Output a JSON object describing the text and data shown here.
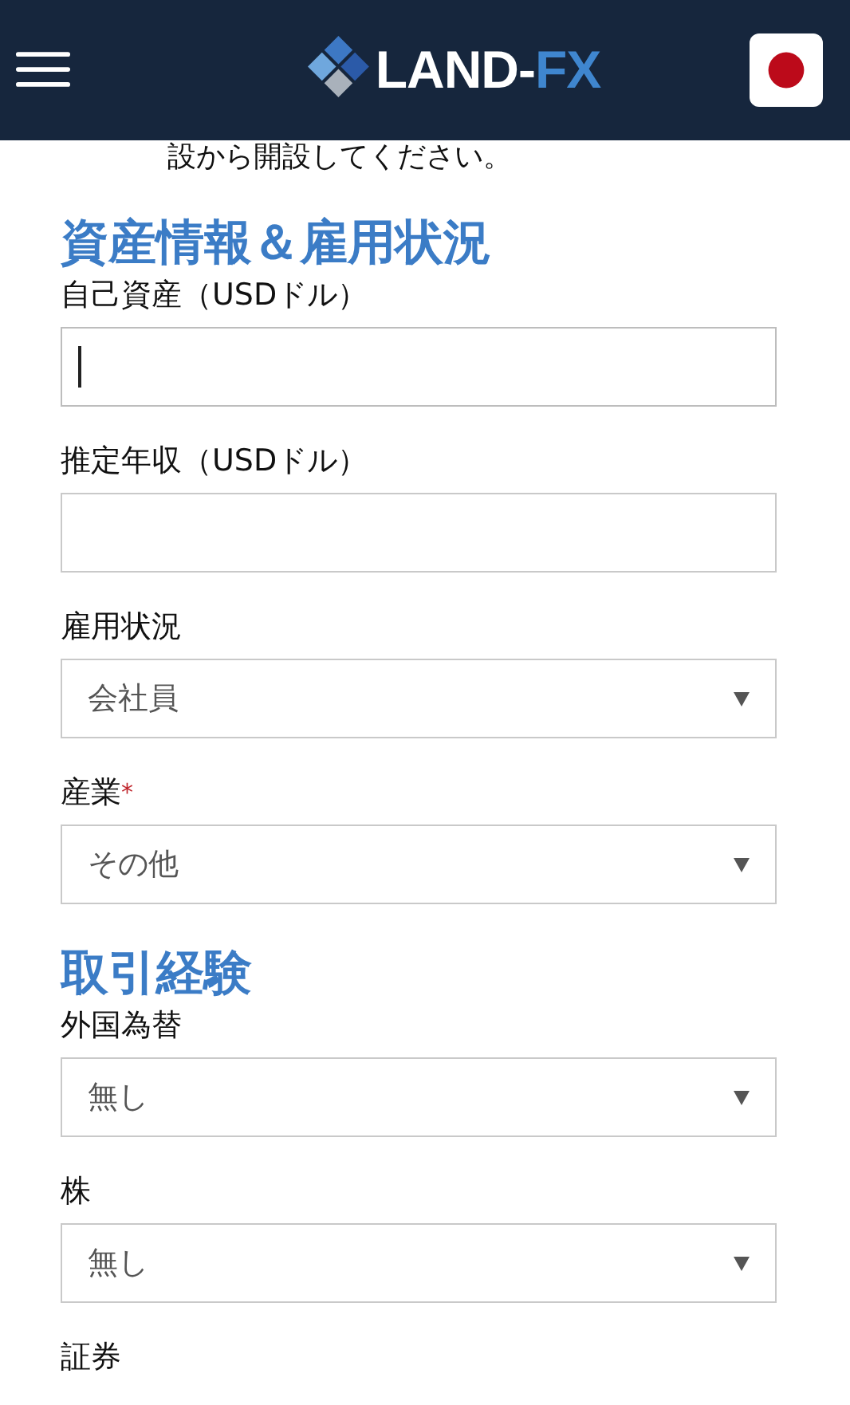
{
  "header": {
    "logo_main": "LAND-",
    "logo_accent": "FX"
  },
  "intro_text": "設から開設してください。",
  "sections": [
    {
      "title": "資産情報＆雇用状況",
      "fields": [
        {
          "kind": "text",
          "label": "自己資産（USDドル）",
          "focused": true
        },
        {
          "kind": "text",
          "label": "推定年収（USDドル）",
          "focused": false
        },
        {
          "kind": "select",
          "label": "雇用状況",
          "value": "会社員",
          "focused": false
        },
        {
          "kind": "select",
          "label": "産業",
          "required_mark": "*",
          "value": "その他",
          "focused": false
        }
      ]
    },
    {
      "title": "取引経験",
      "fields": [
        {
          "kind": "select",
          "label": "外国為替",
          "value": "無し",
          "focused": false
        },
        {
          "kind": "select",
          "label": "株",
          "value": "無し",
          "focused": false
        },
        {
          "kind": "label",
          "label": "証券"
        }
      ]
    }
  ]
}
